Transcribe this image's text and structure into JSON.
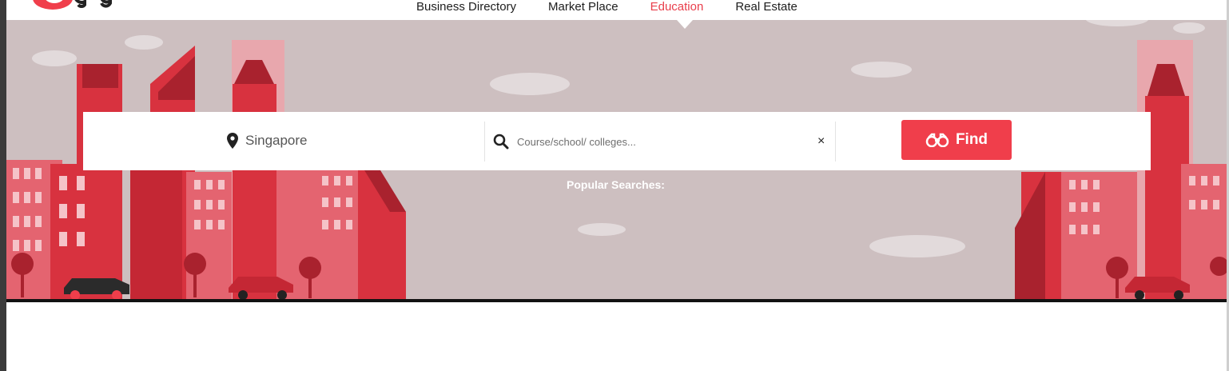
{
  "nav": {
    "items": [
      {
        "label": "Business Directory",
        "active": false
      },
      {
        "label": "Market Place",
        "active": false
      },
      {
        "label": "Education",
        "active": true
      },
      {
        "label": "Real Estate",
        "active": false
      }
    ]
  },
  "search": {
    "location_label": "Singapore",
    "query_placeholder": "Course/school/ colleges...",
    "query_value": "",
    "clear_label": "×",
    "find_label": "Find",
    "location_icon": "map-pin-icon",
    "search_icon": "magnifier-icon",
    "find_icon": "binoculars-icon"
  },
  "popular": {
    "label": "Popular Searches:"
  },
  "colors": {
    "accent": "#f03e4b",
    "hero_bg": "#cdbfc0",
    "building_red": "#d8323f",
    "building_dark": "#a9222e"
  }
}
